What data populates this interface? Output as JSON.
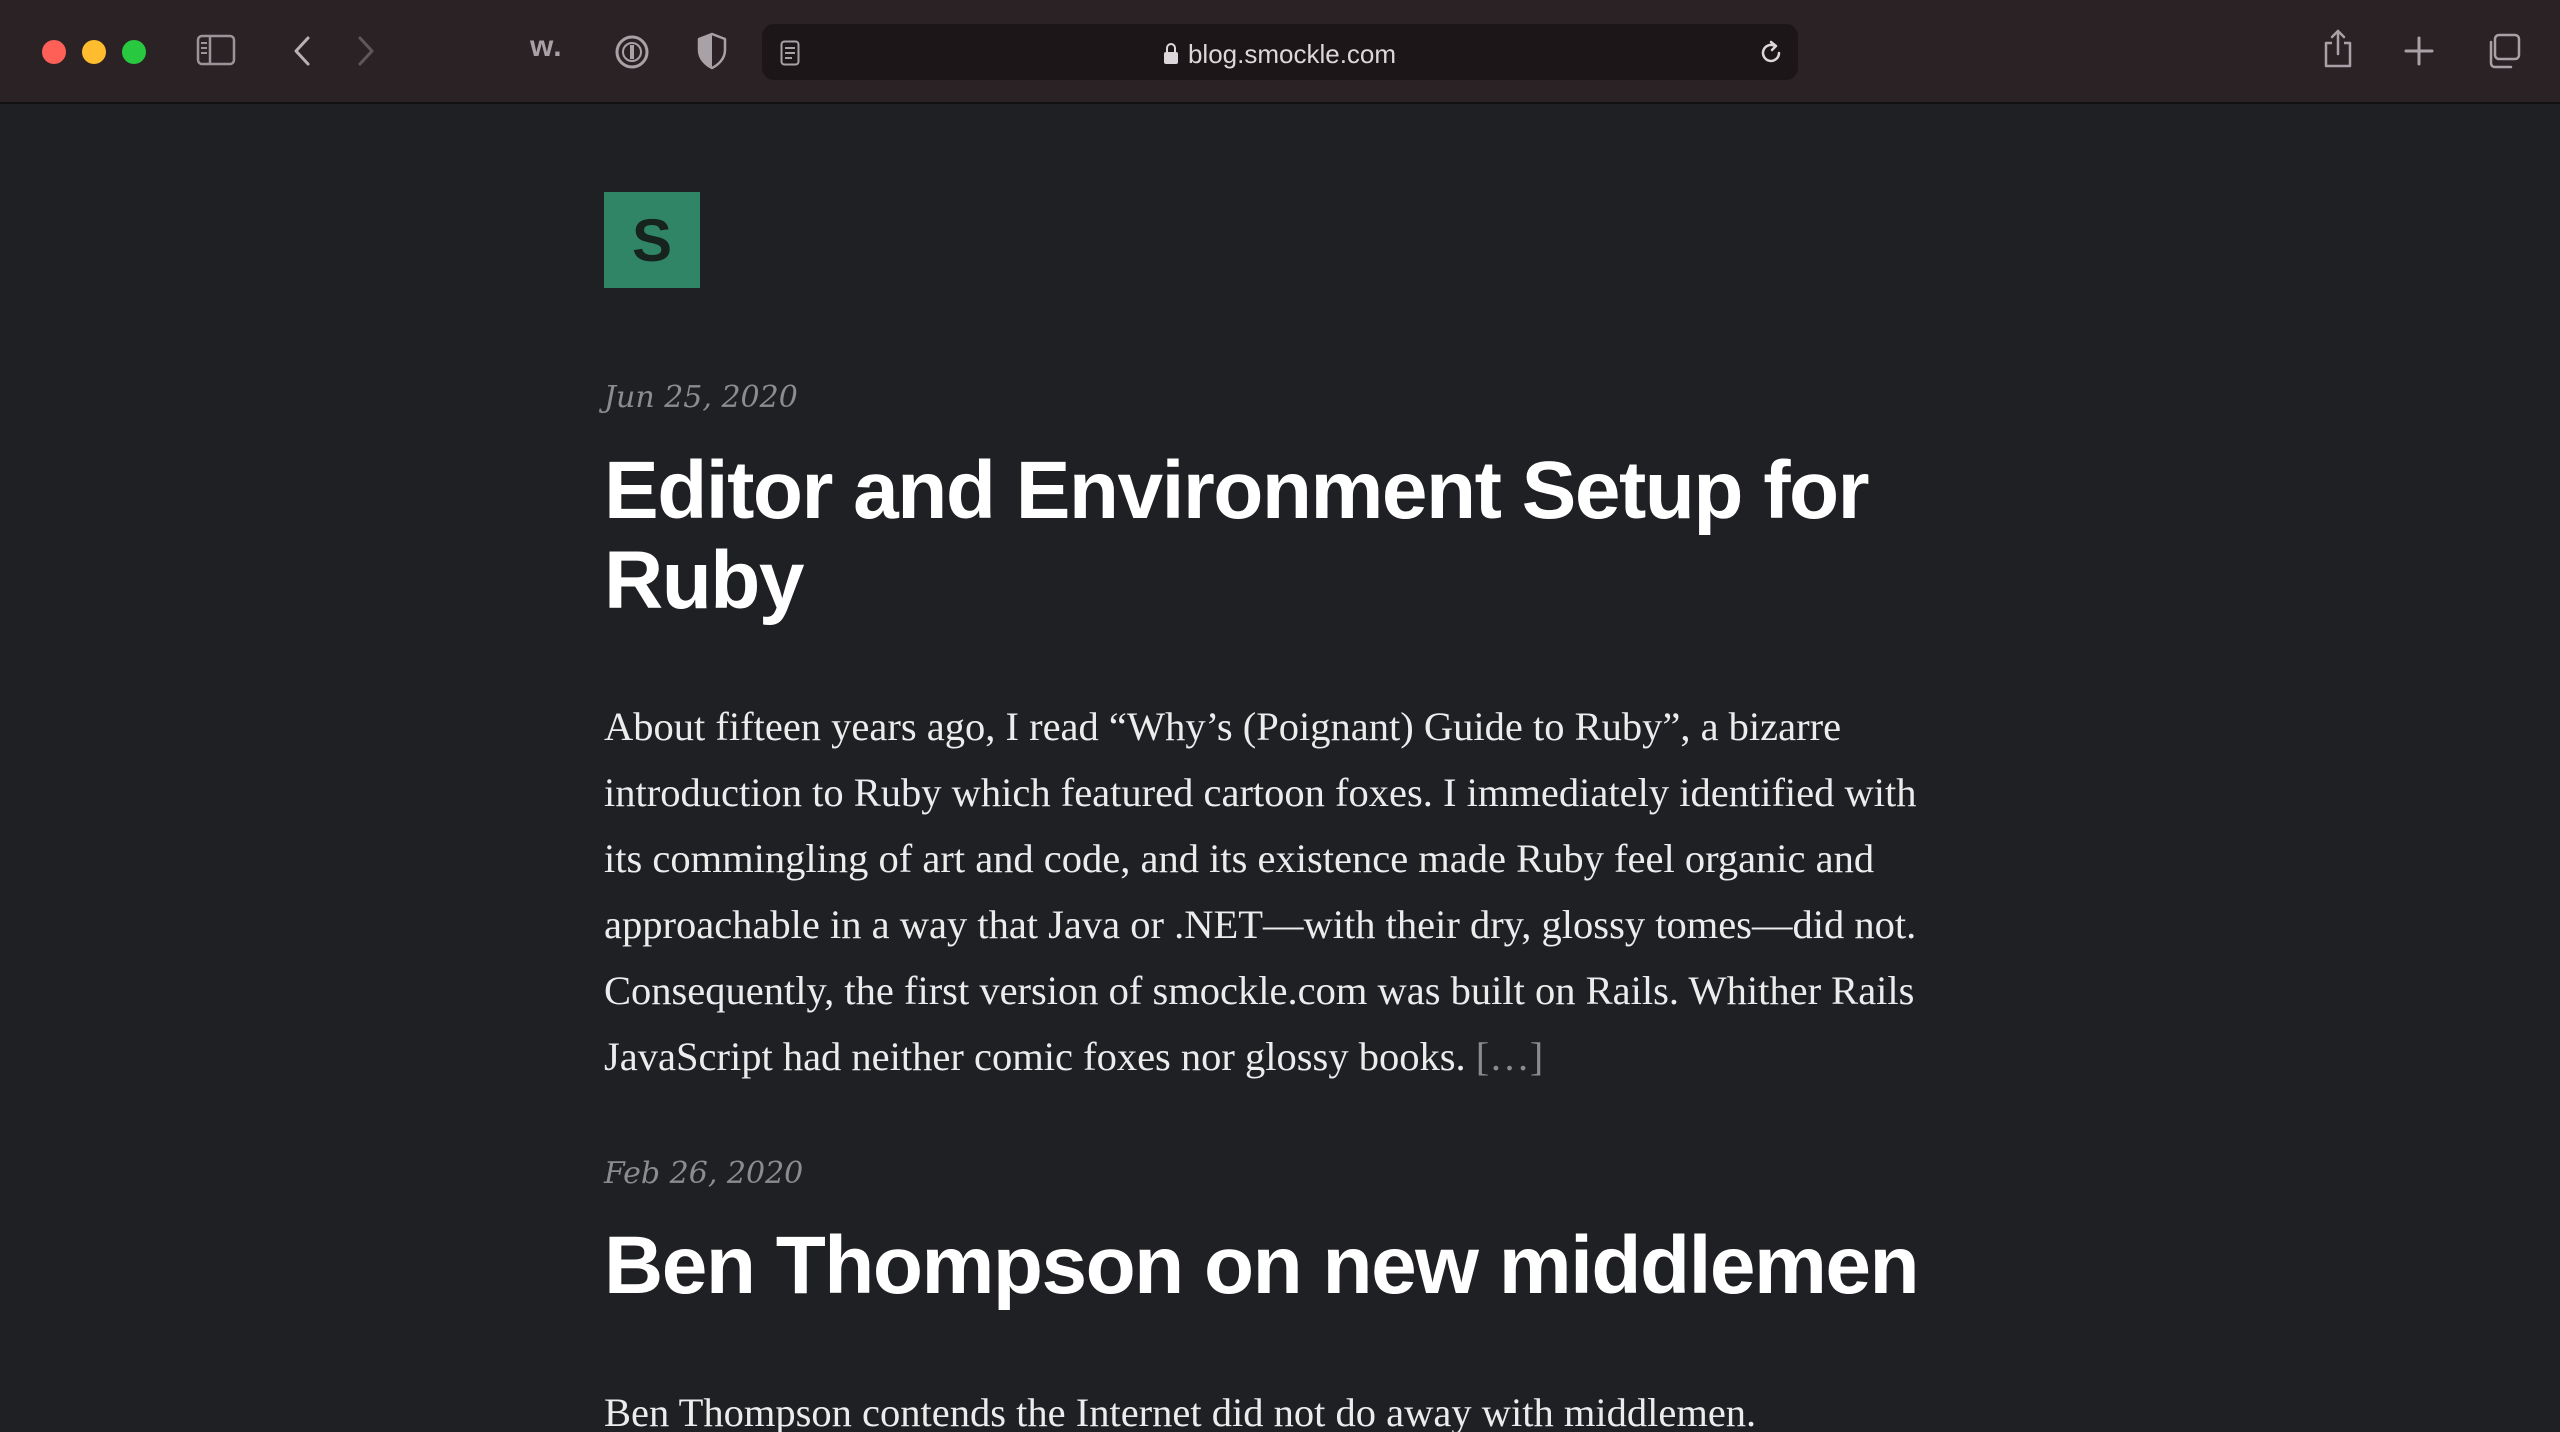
{
  "browser": {
    "url": "blog.smockle.com",
    "extension_label": "w.",
    "accent_colors": {
      "close": "#fe5f57",
      "minimize": "#febc2e",
      "maximize": "#28c840"
    }
  },
  "site": {
    "logo_letter": "S",
    "logo_color": "#2f8566"
  },
  "posts": [
    {
      "date": "Jun 25, 2020",
      "title": "Editor and Environment Setup for Ruby",
      "excerpt": "About fifteen years ago, I read “Why’s (Poignant) Guide to Ruby”, a bizarre introduction to Ruby which featured cartoon foxes. I immediately identified with its commingling of art and code, and its existence made Ruby feel organic and approachable in a way that Java or .NET—with their dry, glossy tomes—did not. Consequently, the first version of smockle.com was built on Rails. Whither Rails JavaScript had neither comic foxes nor glossy books.",
      "more_label": "[…]"
    },
    {
      "date": "Feb 26, 2020",
      "title": "Ben Thompson on new middlemen",
      "excerpt": "Ben Thompson contends the Internet did not do away with middlemen."
    }
  ]
}
